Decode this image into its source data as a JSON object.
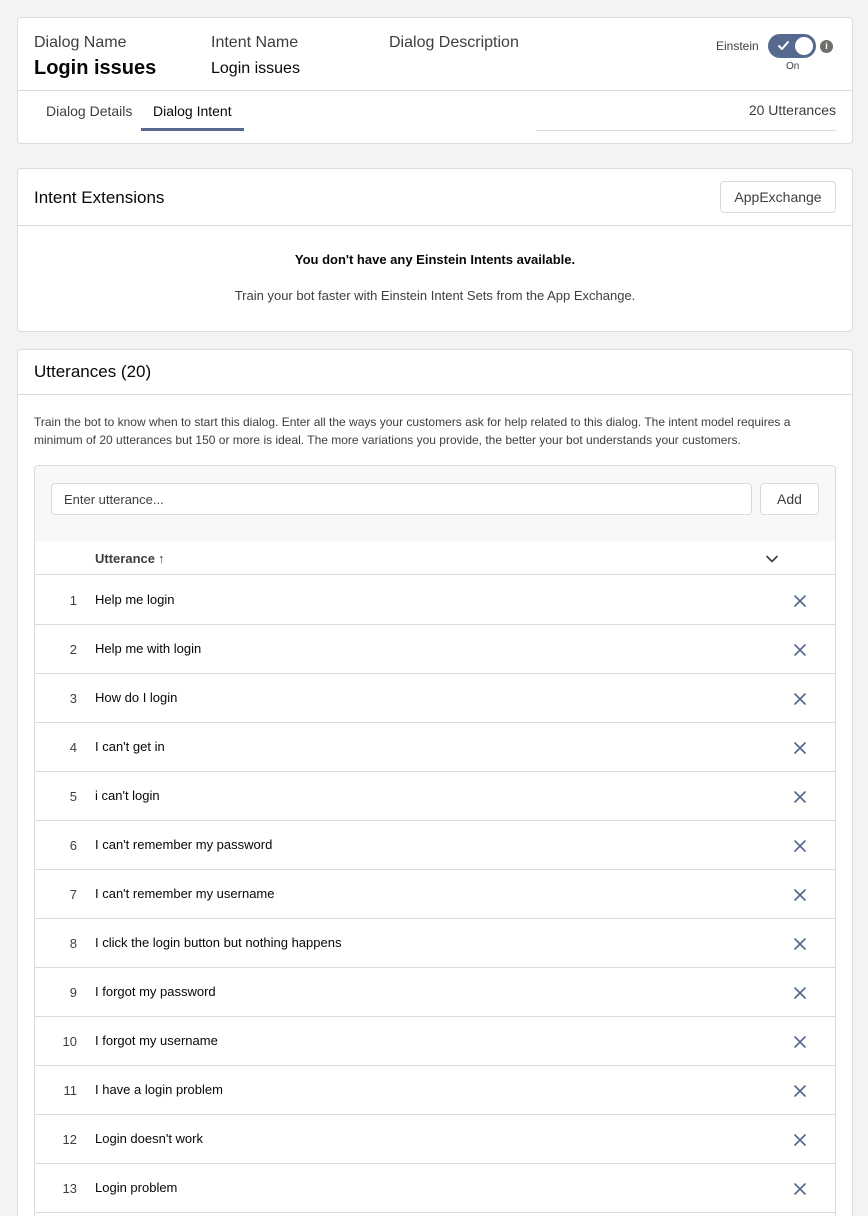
{
  "header": {
    "dialog_name_label": "Dialog Name",
    "dialog_name_value": "Login issues",
    "intent_name_label": "Intent Name",
    "intent_name_value": "Login issues",
    "dialog_description_label": "Dialog Description",
    "einstein_label": "Einstein",
    "einstein_state": "On",
    "tabs": [
      {
        "label": "Dialog Details",
        "active": false
      },
      {
        "label": "Dialog Intent",
        "active": true
      }
    ],
    "utterance_count_text": "20 Utterances"
  },
  "intent_extensions": {
    "title": "Intent Extensions",
    "button_label": "AppExchange",
    "empty_title": "You don't have any Einstein Intents available.",
    "empty_message": "Train your bot faster with Einstein Intent Sets from the App Exchange."
  },
  "utterances": {
    "title": "Utterances (20)",
    "description": "Train the bot to know when to start this dialog. Enter all the ways your customers ask for help related to this dialog. The intent model requires a minimum of 20 utterances but 150 or more is ideal. The more variations you provide, the better your bot understands your customers.",
    "input_placeholder": "Enter utterance...",
    "input_value": "",
    "add_label": "Add",
    "column_header": "Utterance",
    "sort_arrow": "↑",
    "rows": [
      {
        "num": "1",
        "text": "Help me login"
      },
      {
        "num": "2",
        "text": "Help me with login"
      },
      {
        "num": "3",
        "text": "How do I login"
      },
      {
        "num": "4",
        "text": "I can't get in"
      },
      {
        "num": "5",
        "text": "i can't login"
      },
      {
        "num": "6",
        "text": "I can't remember my password"
      },
      {
        "num": "7",
        "text": "I can't remember my username"
      },
      {
        "num": "8",
        "text": "I click the login button but nothing happens"
      },
      {
        "num": "9",
        "text": "I forgot my password"
      },
      {
        "num": "10",
        "text": "I forgot my username"
      },
      {
        "num": "11",
        "text": "I have a login problem"
      },
      {
        "num": "12",
        "text": "Login doesn't work"
      },
      {
        "num": "13",
        "text": "Login problem"
      }
    ]
  },
  "colors": {
    "accent": "#54698d",
    "border": "#dddbda",
    "background": "#f3f3f3"
  },
  "icons": [
    "check-icon",
    "info-icon",
    "chevron-down-icon",
    "close-icon"
  ]
}
